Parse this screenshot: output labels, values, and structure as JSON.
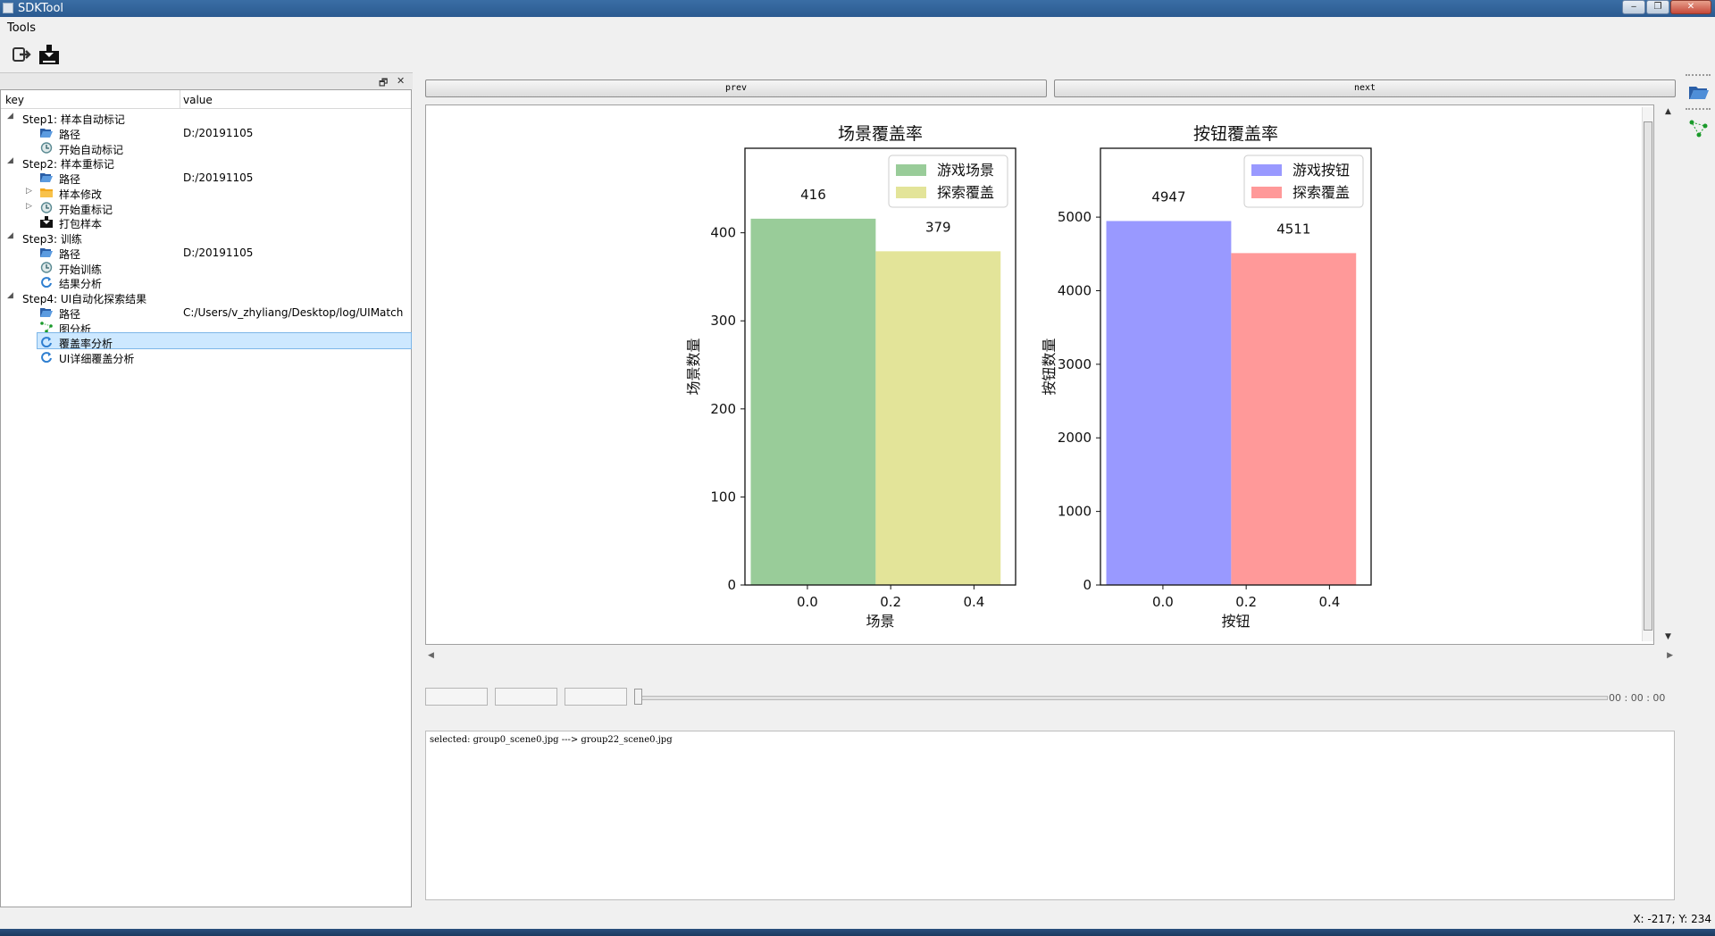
{
  "window": {
    "title": "SDKTool",
    "buttons": [
      "‒",
      "❐",
      "✕"
    ]
  },
  "menu": {
    "tools": "Tools"
  },
  "toolbar": {
    "icons": [
      "exit-icon",
      "save-download-icon"
    ]
  },
  "dock": {
    "float_glyph": "🗗",
    "close_glyph": "✕"
  },
  "tree": {
    "headers": {
      "key": "key",
      "value": "value"
    },
    "rows": [
      {
        "label": "Step1: 样本自动标记",
        "value": "",
        "icon": "",
        "level": 0,
        "expander": "◢"
      },
      {
        "label": "路径",
        "value": "D:/20191105",
        "icon": "folder-open-icon",
        "level": 1,
        "expander": ""
      },
      {
        "label": "开始自动标记",
        "value": "",
        "icon": "clock-icon",
        "level": 1,
        "expander": ""
      },
      {
        "label": "Step2: 样本重标记",
        "value": "",
        "icon": "",
        "level": 0,
        "expander": "◢"
      },
      {
        "label": "路径",
        "value": "D:/20191105",
        "icon": "folder-open-icon",
        "level": 1,
        "expander": ""
      },
      {
        "label": "样本修改",
        "value": "",
        "icon": "folder-icon",
        "level": 1,
        "expander": "▷"
      },
      {
        "label": "开始重标记",
        "value": "",
        "icon": "clock-icon",
        "level": 1,
        "expander": "▷"
      },
      {
        "label": "打包样本",
        "value": "",
        "icon": "save-download-icon",
        "level": 1,
        "expander": ""
      },
      {
        "label": "Step3: 训练",
        "value": "",
        "icon": "",
        "level": 0,
        "expander": "◢"
      },
      {
        "label": "路径",
        "value": "D:/20191105",
        "icon": "folder-open-icon",
        "level": 1,
        "expander": ""
      },
      {
        "label": "开始训练",
        "value": "",
        "icon": "clock-icon",
        "level": 1,
        "expander": ""
      },
      {
        "label": "结果分析",
        "value": "",
        "icon": "refresh-icon",
        "level": 1,
        "expander": ""
      },
      {
        "label": "Step4: UI自动化探索结果",
        "value": "",
        "icon": "",
        "level": 0,
        "expander": "◢"
      },
      {
        "label": "路径",
        "value": "C:/Users/v_zhyliang/Desktop/log/UIMatch",
        "icon": "folder-open-icon",
        "level": 1,
        "expander": ""
      },
      {
        "label": "图分析",
        "value": "",
        "icon": "graph-icon",
        "level": 1,
        "expander": ""
      },
      {
        "label": "覆盖率分析",
        "value": "",
        "icon": "refresh-icon",
        "level": 1,
        "expander": "",
        "selected": true
      },
      {
        "label": "UI详细覆盖分析",
        "value": "",
        "icon": "refresh-icon",
        "level": 1,
        "expander": ""
      }
    ]
  },
  "nav": {
    "prev": "prev",
    "next": "next"
  },
  "chart_data": [
    {
      "type": "bar",
      "title": "场景覆盖率",
      "xlabel": "场景",
      "ylabel": "场景数量",
      "x_ticks": [
        "0.0",
        "0.2",
        "0.4"
      ],
      "ylim": [
        0,
        496
      ],
      "y_ticks": [
        0,
        100,
        200,
        300,
        400
      ],
      "series": [
        {
          "name": "游戏场景",
          "value": 416,
          "color": "#99cc99"
        },
        {
          "name": "探索覆盖",
          "value": 379,
          "color": "#e3e499"
        }
      ],
      "legend": "top-right"
    },
    {
      "type": "bar",
      "title": "按钮覆盖率",
      "xlabel": "按钮",
      "ylabel": "按钮数量",
      "x_ticks": [
        "0.0",
        "0.2",
        "0.4"
      ],
      "ylim": [
        0,
        5936
      ],
      "y_ticks": [
        0,
        1000,
        2000,
        3000,
        4000,
        5000
      ],
      "series": [
        {
          "name": "游戏按钮",
          "value": 4947,
          "color": "#9999ff"
        },
        {
          "name": "探索覆盖",
          "value": 4511,
          "color": "#ff9999"
        }
      ],
      "legend": "top-right"
    }
  ],
  "player": {
    "timecode": "00 : 00 : 00"
  },
  "console": {
    "text": "selected: group0_scene0.jpg ---> group22_scene0.jpg"
  },
  "status": {
    "coords": "X: -217; Y: 234"
  }
}
